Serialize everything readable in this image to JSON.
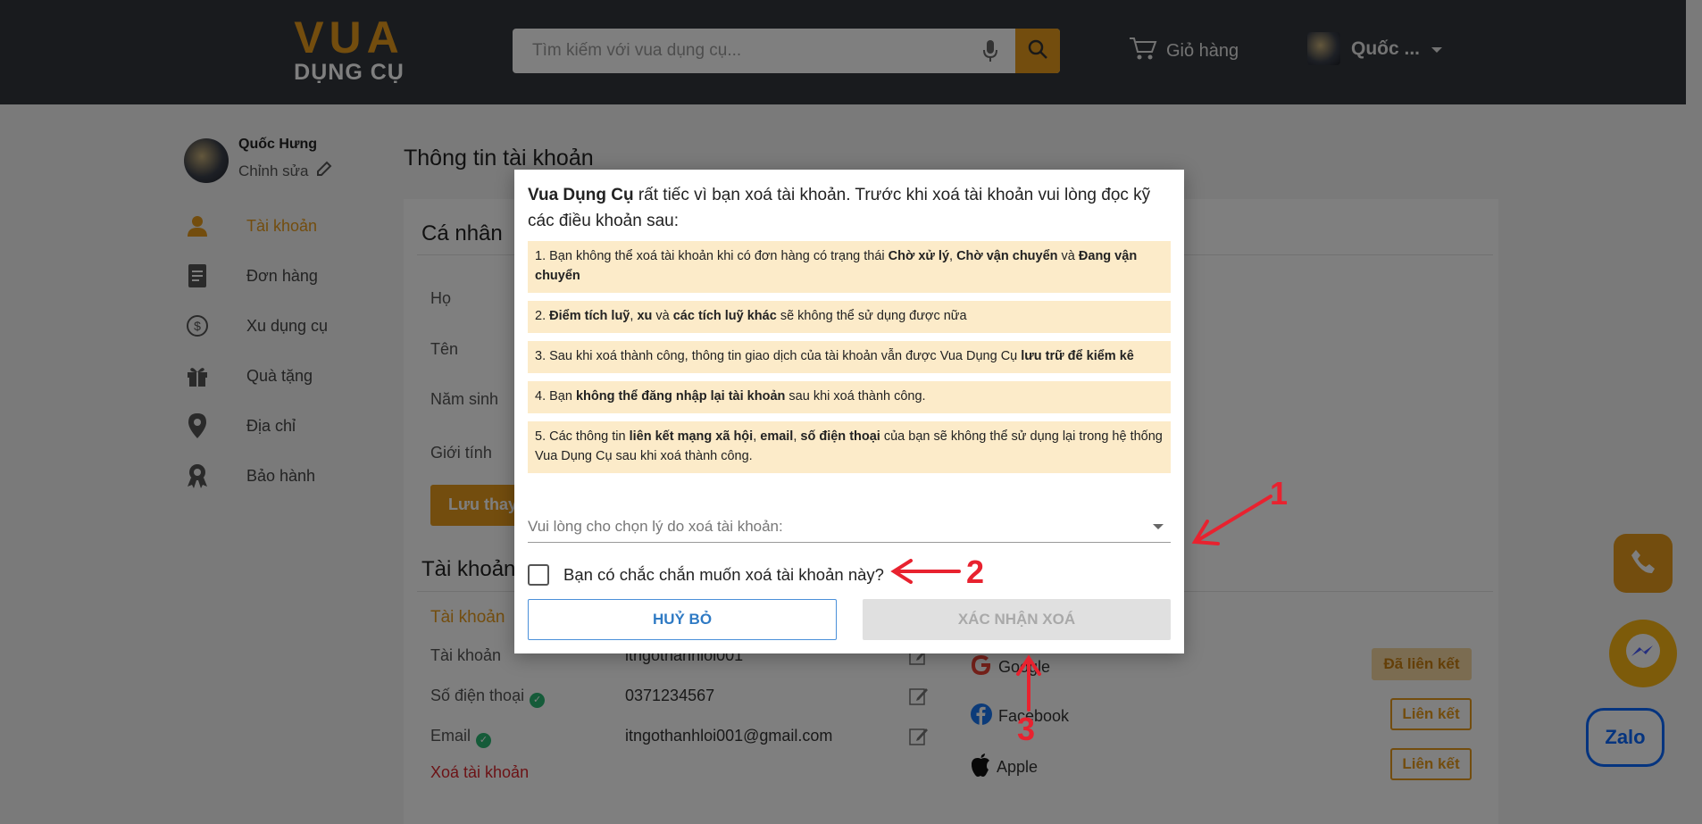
{
  "header": {
    "logo_top": "VUA",
    "logo_bottom": "DỤNG CỤ",
    "search_placeholder": "Tìm kiếm với vua dụng cụ...",
    "cart_label": "Giỏ hàng",
    "user_name": "Quốc ..."
  },
  "sidebar": {
    "profile_name": "Quốc Hưng",
    "profile_edit": "Chỉnh sửa",
    "items": [
      {
        "label": "Tài khoản",
        "icon": "user-icon",
        "active": true
      },
      {
        "label": "Đơn hàng",
        "icon": "document-icon"
      },
      {
        "label": "Xu dụng cụ",
        "icon": "coin-icon"
      },
      {
        "label": "Quà tặng",
        "icon": "gift-icon"
      },
      {
        "label": "Địa chỉ",
        "icon": "location-pin-icon"
      },
      {
        "label": "Bảo hành",
        "icon": "warranty-badge-icon"
      }
    ]
  },
  "main": {
    "title": "Thông tin tài khoản",
    "personal": {
      "title": "Cá nhân",
      "fields": [
        "Họ",
        "Tên",
        "Năm sinh",
        "Giới tính"
      ],
      "save_label": "Lưu thay đổi"
    },
    "account": {
      "title": "Tài khoản",
      "subtitle": "Tài khoản",
      "rows": [
        {
          "label": "Tài khoản",
          "value": "itngothanhloi001"
        },
        {
          "label": "Số điện thoại",
          "value": "0371234567"
        },
        {
          "label": "Email",
          "value": "itngothanhloi001@gmail.com"
        }
      ],
      "delete_label": "Xoá tài khoản"
    },
    "social": [
      {
        "name": "Google",
        "action": "Đã liên kết"
      },
      {
        "name": "Facebook",
        "action": "Liên kết"
      },
      {
        "name": "Apple",
        "action": "Liên kết"
      }
    ]
  },
  "modal": {
    "intro_brand": "Vua Dụng Cụ",
    "intro_text": " rất tiếc vì bạn xoá tài khoản. Trước khi xoá tài khoản vui lòng đọc kỹ các điều khoản sau:",
    "terms": {
      "t1_a": "1. Bạn không thể xoá tài khoản khi có đơn hàng có trạng thái ",
      "t1_b": "Chờ xử lý",
      "t1_c": ", ",
      "t1_d": "Chờ vận chuyển",
      "t1_e": " và ",
      "t1_f": "Đang vận chuyển",
      "t2_a": "2. ",
      "t2_b": "Điểm tích luỹ",
      "t2_c": ", ",
      "t2_d": "xu",
      "t2_e": " và ",
      "t2_f": "các tích luỹ khác",
      "t2_g": " sẽ không thể sử dụng được nữa",
      "t3_a": "3. Sau khi xoá thành công, thông tin giao dịch của tài khoản vẫn được Vua Dụng Cụ ",
      "t3_b": "lưu trữ để kiểm kê",
      "t4_a": "4. Bạn ",
      "t4_b": "không thể đăng nhập lại tài khoản",
      "t4_c": " sau khi xoá thành công.",
      "t5_a": "5. Các thông tin ",
      "t5_b": "liên kết mạng xã hội",
      "t5_c": ", ",
      "t5_d": "email",
      "t5_e": ", ",
      "t5_f": "số điện thoại",
      "t5_g": " của bạn sẽ không thể sử dụng lại trong hệ thống Vua Dụng Cụ sau khi xoá thành công."
    },
    "reason_placeholder": "Vui lòng cho chọn lý do xoá tài khoản:",
    "confirm_checkbox_label": "Bạn có chắc chắn muốn xoá tài khoản này?",
    "cancel_label": "HUỶ BỎ",
    "confirm_label": "XÁC NHẬN XOÁ"
  },
  "annotations": [
    "1",
    "2",
    "3"
  ],
  "widgets": {
    "zalo_label": "Zalo"
  },
  "colors": {
    "accent": "#e69a1c",
    "header_bg": "#33373d",
    "term_bg": "#fcebc9",
    "annotation": "#e8222f"
  }
}
